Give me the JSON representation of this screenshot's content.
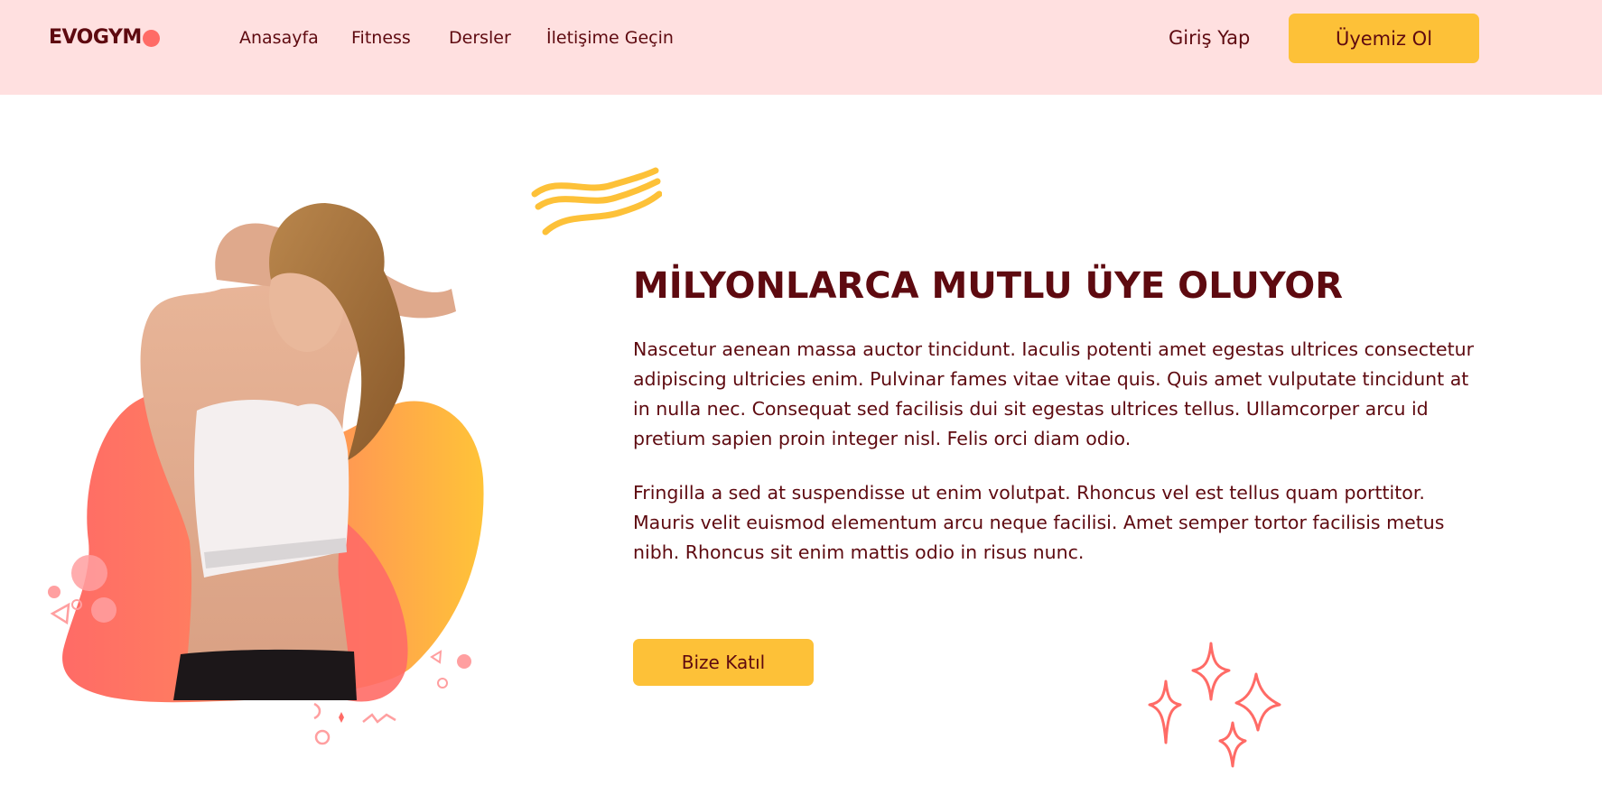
{
  "brand": {
    "logo_text": "EVOGYM"
  },
  "nav": {
    "links": [
      "Anasayfa",
      "Fitness",
      "Dersler",
      "İletişime Geçin"
    ],
    "login_label": "Giriş Yap",
    "signup_label": "Üyemiz Ol"
  },
  "hero": {
    "title": "MİLYONLARCA MUTLU ÜYE OLUYOR",
    "paragraph_1": "Nascetur aenean massa auctor tincidunt. Iaculis potenti amet egestas ultrices consectetur adipiscing ultricies enim. Pulvinar fames vitae vitae quis. Quis amet vulputate tincidunt at in nulla nec. Consequat sed facilisis dui sit egestas ultrices tellus. Ullamcorper arcu id pretium sapien proin integer nisl. Felis orci diam odio.",
    "paragraph_2": "Fringilla a sed at suspendisse ut enim volutpat. Rhoncus vel est tellus quam porttitor. Mauris velit euismod elementum arcu neque facilisi. Amet semper tortor facilisis metus nibh. Rhoncus sit enim mattis odio in risus nunc.",
    "cta_label": "Bize Katıl"
  },
  "colors": {
    "nav_background": "#ffe0e0",
    "primary_text": "#5e0a10",
    "accent_yellow": "#fdc138",
    "accent_coral": "#ff6b66"
  },
  "icons": [
    "waves-icon",
    "sparkles-icon"
  ]
}
